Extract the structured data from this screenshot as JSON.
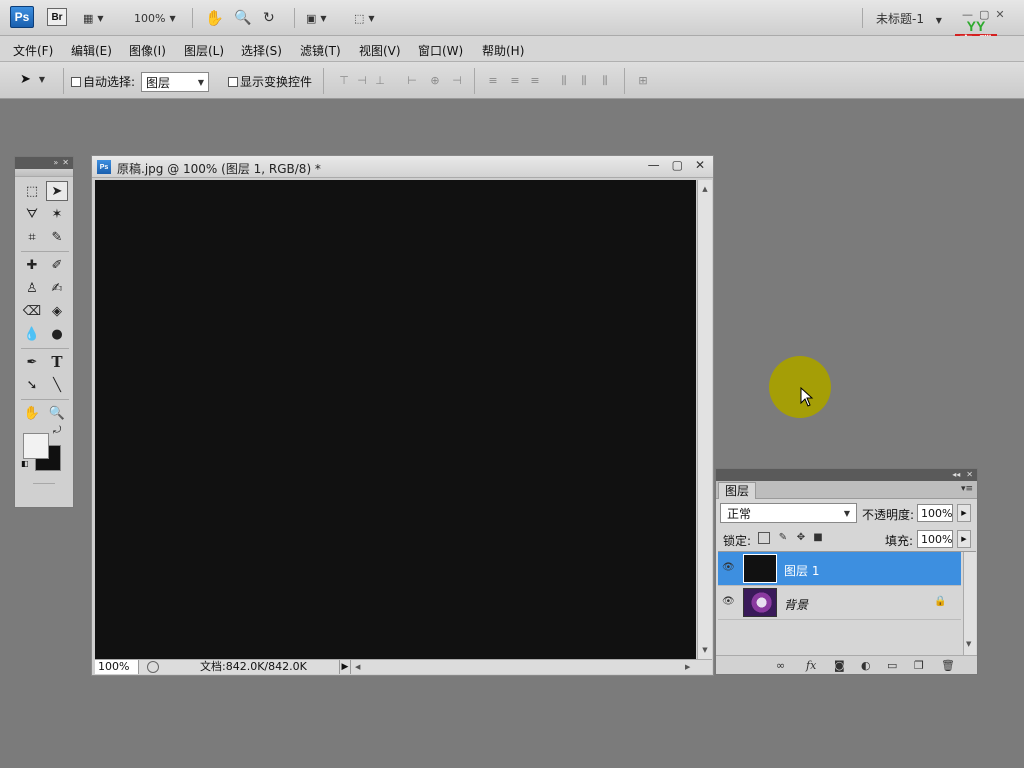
{
  "app": {
    "logo": "Ps",
    "bridge": "Br",
    "zoom": "100%",
    "doc_title": "未标题-1",
    "window_controls": [
      "—",
      "▢",
      "✕"
    ]
  },
  "brand": {
    "top": "YY",
    "chars": [
      "育",
      "碟",
      "教",
      "育"
    ]
  },
  "menu": {
    "items": [
      "文件(F)",
      "编辑(E)",
      "图像(I)",
      "图层(L)",
      "选择(S)",
      "滤镜(T)",
      "视图(V)",
      "窗口(W)",
      "帮助(H)"
    ]
  },
  "options": {
    "auto_select_label": "自动选择:",
    "auto_select_value": "图层",
    "show_transform_label": "显示变换控件"
  },
  "document": {
    "logo": "Ps",
    "title": "原稿.jpg @ 100% (图层 1, RGB/8) *",
    "zoom": "100%",
    "info": "文档:842.0K/842.0K"
  },
  "layers": {
    "tab": "图层",
    "blend_mode": "正常",
    "opacity_label": "不透明度:",
    "opacity": "100%",
    "lock_label": "锁定:",
    "fill_label": "填充:",
    "fill": "100%",
    "items": [
      {
        "name": "图层 1",
        "selected": true
      },
      {
        "name": "背景",
        "selected": false
      }
    ]
  },
  "colors": {
    "foreground": "#f2f2f2",
    "background": "#101010",
    "selection": "#3d8fe0",
    "cursor_highlight": "#a8a000"
  }
}
